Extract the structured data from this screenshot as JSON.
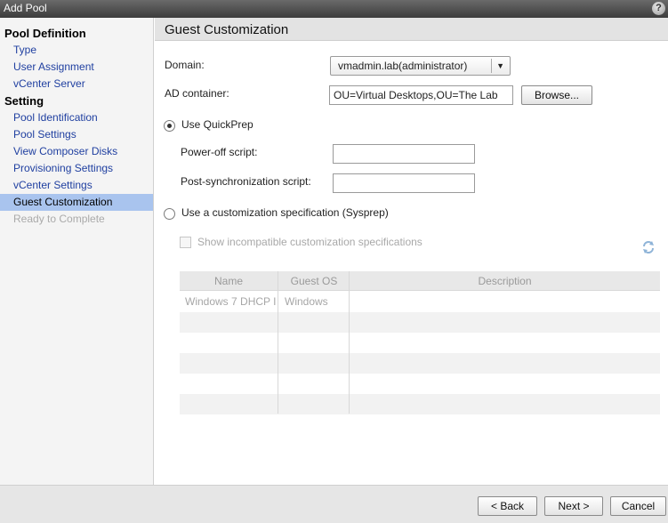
{
  "window": {
    "title": "Add Pool",
    "help_icon": "?"
  },
  "sidebar": {
    "sections": [
      {
        "label": "Pool Definition",
        "items": [
          {
            "label": "Type"
          },
          {
            "label": "User Assignment"
          },
          {
            "label": "vCenter Server"
          }
        ]
      },
      {
        "label": "Setting",
        "items": [
          {
            "label": "Pool Identification"
          },
          {
            "label": "Pool Settings"
          },
          {
            "label": "View Composer Disks"
          },
          {
            "label": "Provisioning Settings"
          },
          {
            "label": "vCenter Settings"
          },
          {
            "label": "Guest Customization",
            "selected": true
          },
          {
            "label": "Ready to Complete",
            "disabled": true
          }
        ]
      }
    ]
  },
  "main": {
    "header": "Guest Customization",
    "domain": {
      "label": "Domain:",
      "value": "vmadmin.lab(administrator)"
    },
    "ad_container": {
      "label": "AD container:",
      "value": "OU=Virtual Desktops,OU=The Lab",
      "browse_label": "Browse..."
    },
    "quickprep": {
      "label": "Use QuickPrep",
      "selected": true,
      "poweroff_label": "Power-off script:",
      "poweroff_value": "",
      "postsync_label": "Post-synchronization script:",
      "postsync_value": ""
    },
    "sysprep": {
      "label": "Use a customization specification (Sysprep)",
      "selected": false,
      "show_incompatible_label": "Show incompatible customization specifications"
    },
    "grid": {
      "columns": [
        "Name",
        "Guest OS",
        "Description"
      ],
      "rows": [
        {
          "name": "Windows 7 DHCP I",
          "guest_os": "Windows",
          "description": ""
        }
      ]
    }
  },
  "footer": {
    "back_label": "< Back",
    "next_label": "Next >",
    "cancel_label": "Cancel"
  }
}
